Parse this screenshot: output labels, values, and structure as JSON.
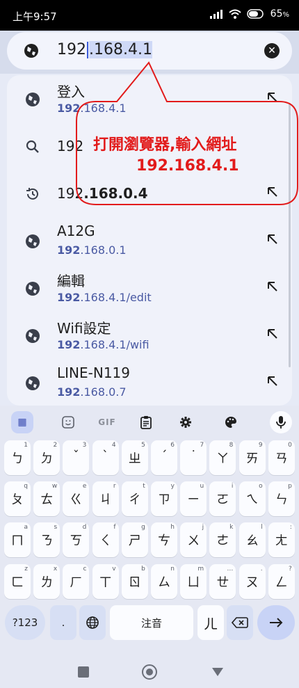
{
  "status": {
    "time": "上午9:57",
    "battery": "65"
  },
  "url": {
    "prefix": "192",
    "selected": ".168.4.1"
  },
  "suggestions": [
    {
      "title": "登入",
      "bold": "192",
      "rest": ".168.4.1",
      "icon": "globe-icon",
      "arrow": true
    },
    {
      "single": "192",
      "icon": "search-icon",
      "arrow": false
    },
    {
      "single_prefix": "192",
      "single_bold": ".168.0.4",
      "icon": "history-icon",
      "arrow": true
    },
    {
      "title": "A12G",
      "bold": "192",
      "rest": ".168.0.1",
      "icon": "globe-icon",
      "arrow": true
    },
    {
      "title": "編輯",
      "bold": "192",
      "rest": ".168.4.1/edit",
      "icon": "globe-icon",
      "arrow": true
    },
    {
      "title": "Wifi設定",
      "bold": "192",
      "rest": ".168.4.1/wifi",
      "icon": "globe-icon",
      "arrow": true
    },
    {
      "title": "LINE-N119",
      "bold": "192",
      "rest": ".168.0.7",
      "icon": "globe-icon",
      "arrow": true
    }
  ],
  "annotation": {
    "line1": "打開瀏覽器,輸入網址",
    "line2": "192.168.4.1",
    "color": "#e21b1b"
  },
  "keyboard": {
    "toolbar": [
      "apps-grid-icon",
      "sticker-icon",
      "GIF",
      "clipboard-icon",
      "gear-icon",
      "palette-icon",
      "mic-icon"
    ],
    "gif_label": "GIF",
    "row1": [
      [
        "ㄅ",
        "1"
      ],
      [
        "ㄉ",
        "2"
      ],
      [
        "ˇ",
        "3"
      ],
      [
        "ˋ",
        "4"
      ],
      [
        "ㄓ",
        "5"
      ],
      [
        "ˊ",
        "6"
      ],
      [
        "˙",
        "7"
      ],
      [
        "ㄚ",
        "8"
      ],
      [
        "ㄞ",
        "9"
      ],
      [
        "ㄢ",
        "0"
      ]
    ],
    "row2": [
      [
        "ㄆ",
        "q"
      ],
      [
        "ㄊ",
        "w"
      ],
      [
        "ㄍ",
        "e"
      ],
      [
        "ㄐ",
        "r"
      ],
      [
        "ㄔ",
        "t"
      ],
      [
        "ㄗ",
        "y"
      ],
      [
        "ㄧ",
        "u"
      ],
      [
        "ㄛ",
        "i"
      ],
      [
        "ㄟ",
        "o"
      ],
      [
        "ㄣ",
        "p"
      ]
    ],
    "row3": [
      [
        "ㄇ",
        "a"
      ],
      [
        "ㄋ",
        "s"
      ],
      [
        "ㄎ",
        "d"
      ],
      [
        "ㄑ",
        "f"
      ],
      [
        "ㄕ",
        "g"
      ],
      [
        "ㄘ",
        "h"
      ],
      [
        "ㄨ",
        "j"
      ],
      [
        "ㄜ",
        "k"
      ],
      [
        "ㄠ",
        "l"
      ],
      [
        "ㄤ",
        ":"
      ]
    ],
    "row4": [
      [
        "ㄈ",
        "z"
      ],
      [
        "ㄌ",
        "x"
      ],
      [
        "ㄏ",
        "c"
      ],
      [
        "ㄒ",
        "v"
      ],
      [
        "ㄖ",
        "b"
      ],
      [
        "ㄙ",
        "n"
      ],
      [
        "ㄩ",
        "m"
      ],
      [
        "ㄝ",
        "…"
      ],
      [
        "ㄡ",
        "."
      ],
      [
        "ㄥ",
        "?"
      ]
    ],
    "bottom": {
      "sym": "?123",
      "dot": ".",
      "space": "注音",
      "er": "ㄦ"
    }
  }
}
